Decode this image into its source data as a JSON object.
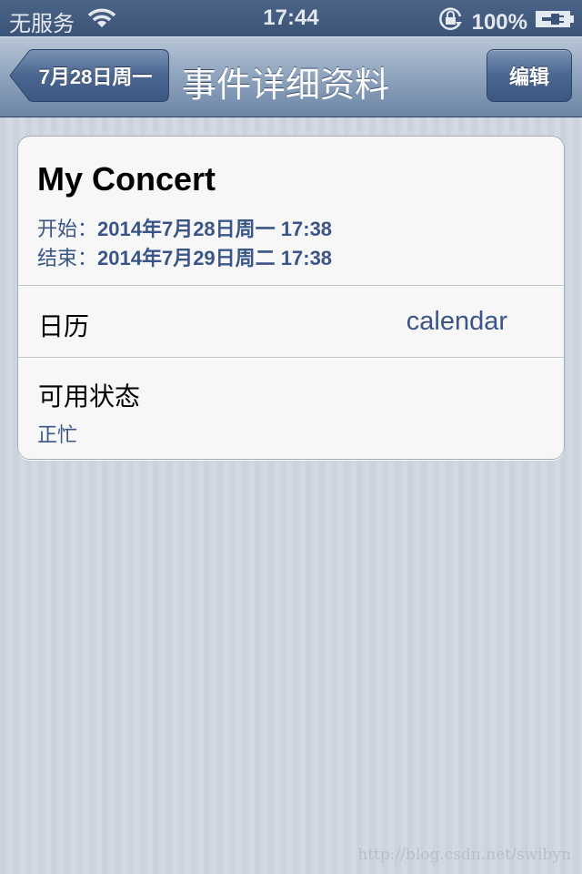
{
  "status_bar": {
    "carrier": "无服务",
    "wifi_icon": "wifi-icon",
    "time": "17:44",
    "rotation_lock_icon": "rotation-lock-icon",
    "battery_percent": "100%",
    "battery_icon": "battery-charging-icon"
  },
  "nav_bar": {
    "back_label": "7月28日周一",
    "title": "事件详细资料",
    "edit_label": "编辑"
  },
  "event": {
    "title": "My Concert",
    "start_label": "开始：",
    "start_value": "2014年7月28日周一 17:38",
    "end_label": "结束：",
    "end_value": "2014年7月29日周二 17:38"
  },
  "calendar_row": {
    "label": "日历",
    "value": "calendar"
  },
  "availability_row": {
    "label": "可用状态",
    "value": "正忙"
  },
  "watermark": "http://blog.csdn.net/swibyn",
  "colors": {
    "accent_text": "#3a5587",
    "nav_dark": "#3b5478"
  }
}
